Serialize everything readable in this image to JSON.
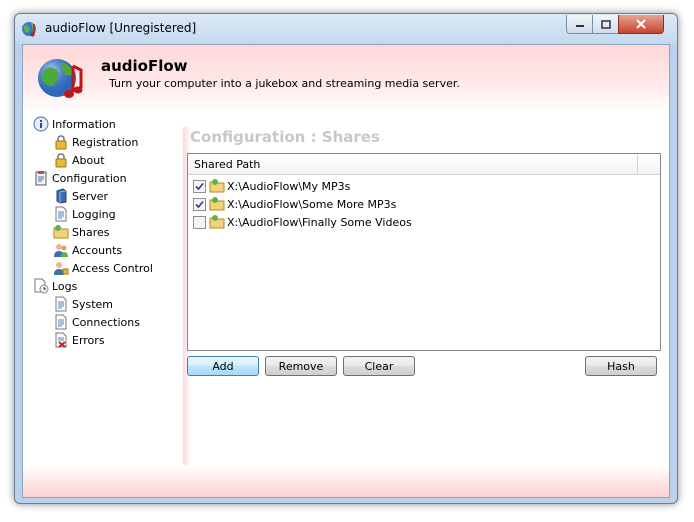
{
  "window": {
    "title": "audioFlow [Unregistered]"
  },
  "header": {
    "app_name": "audioFlow",
    "tagline": "Turn your computer into a jukebox and streaming media server."
  },
  "sidebar": {
    "items": [
      {
        "label": "Information",
        "icon": "info-icon",
        "level": 0
      },
      {
        "label": "Registration",
        "icon": "lock-icon",
        "level": 1
      },
      {
        "label": "About",
        "icon": "lock-icon",
        "level": 1
      },
      {
        "label": "Configuration",
        "icon": "clipboard-icon",
        "level": 0
      },
      {
        "label": "Server",
        "icon": "server-icon",
        "level": 1
      },
      {
        "label": "Logging",
        "icon": "document-icon",
        "level": 1
      },
      {
        "label": "Shares",
        "icon": "shared-folder-icon",
        "level": 1
      },
      {
        "label": "Accounts",
        "icon": "users-icon",
        "level": 1
      },
      {
        "label": "Access Control",
        "icon": "user-lock-icon",
        "level": 1
      },
      {
        "label": "Logs",
        "icon": "log-icon",
        "level": 0
      },
      {
        "label": "System",
        "icon": "document-icon",
        "level": 1
      },
      {
        "label": "Connections",
        "icon": "document-icon",
        "level": 1
      },
      {
        "label": "Errors",
        "icon": "error-document-icon",
        "level": 1
      }
    ]
  },
  "main": {
    "section_title": "Configuration : Shares",
    "list": {
      "column_header": "Shared Path",
      "rows": [
        {
          "path": "X:\\AudioFlow\\My MP3s",
          "checked": true
        },
        {
          "path": "X:\\AudioFlow\\Some More MP3s",
          "checked": true
        },
        {
          "path": "X:\\AudioFlow\\Finally Some Videos",
          "checked": false
        }
      ]
    },
    "buttons": {
      "add": "Add",
      "remove": "Remove",
      "clear": "Clear",
      "hash": "Hash"
    }
  },
  "colors": {
    "header_accent": "#ffd6d6",
    "section_title": "#c8c8c8",
    "titlebar": "#c4d8ee",
    "close_button": "#c7432e"
  }
}
